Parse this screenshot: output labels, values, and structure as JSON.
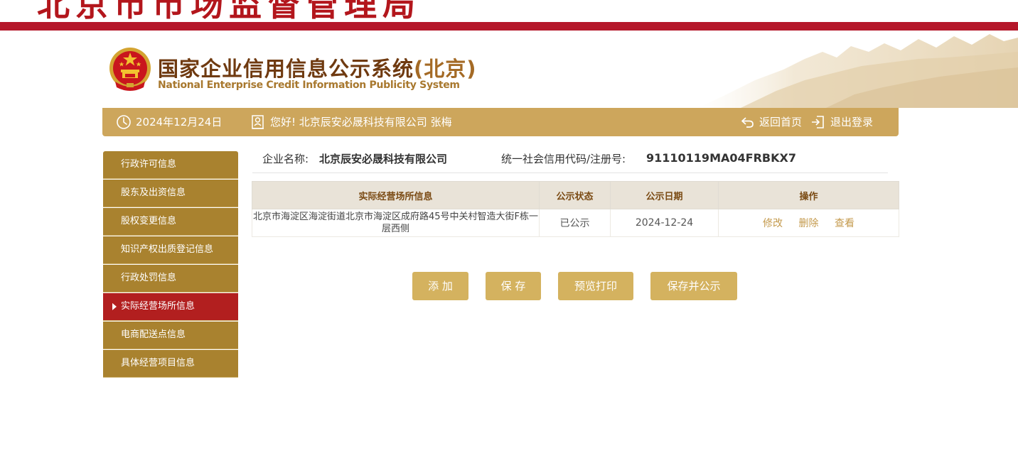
{
  "banner": {
    "title": "北京市市场监督管理局"
  },
  "header": {
    "logo_cn": "国家企业信用信息公示系统",
    "logo_cn_region": "(北京)",
    "logo_en": "National Enterprise Credit Information Publicity System"
  },
  "infobar": {
    "date": "2024年12月24日",
    "greeting": "您好!",
    "company": "北京辰安必晟科技有限公司",
    "user": "张梅",
    "home_label": "返回首页",
    "logout_label": "退出登录"
  },
  "sidebar": {
    "items": [
      {
        "label": "行政许可信息"
      },
      {
        "label": "股东及出资信息"
      },
      {
        "label": "股权变更信息"
      },
      {
        "label": "知识产权出质登记信息"
      },
      {
        "label": "行政处罚信息"
      },
      {
        "label": "实际经营场所信息",
        "active": true
      },
      {
        "label": "电商配送点信息"
      },
      {
        "label": "具体经营项目信息"
      }
    ]
  },
  "company": {
    "name_label": "企业名称:",
    "name": "北京辰安必晟科技有限公司",
    "code_label": "统一社会信用代码/注册号:",
    "code": "91110119MA04FRBKX7"
  },
  "table": {
    "headers": [
      "实际经营场所信息",
      "公示状态",
      "公示日期",
      "操作"
    ],
    "rows": [
      {
        "address": "北京市海淀区海淀街道北京市海淀区成府路45号中关村智造大街F栋一层西侧",
        "status": "已公示",
        "date": "2024-12-24",
        "actions": [
          "修改",
          "删除",
          "查看"
        ]
      }
    ]
  },
  "buttons": {
    "add": "添 加",
    "save": "保 存",
    "preview": "预览打印",
    "save_publish": "保存并公示"
  },
  "colors": {
    "brand_red": "#b5172a",
    "gold": "#cda65c",
    "sidebar": "#a9822f",
    "active": "#b21f1f"
  }
}
